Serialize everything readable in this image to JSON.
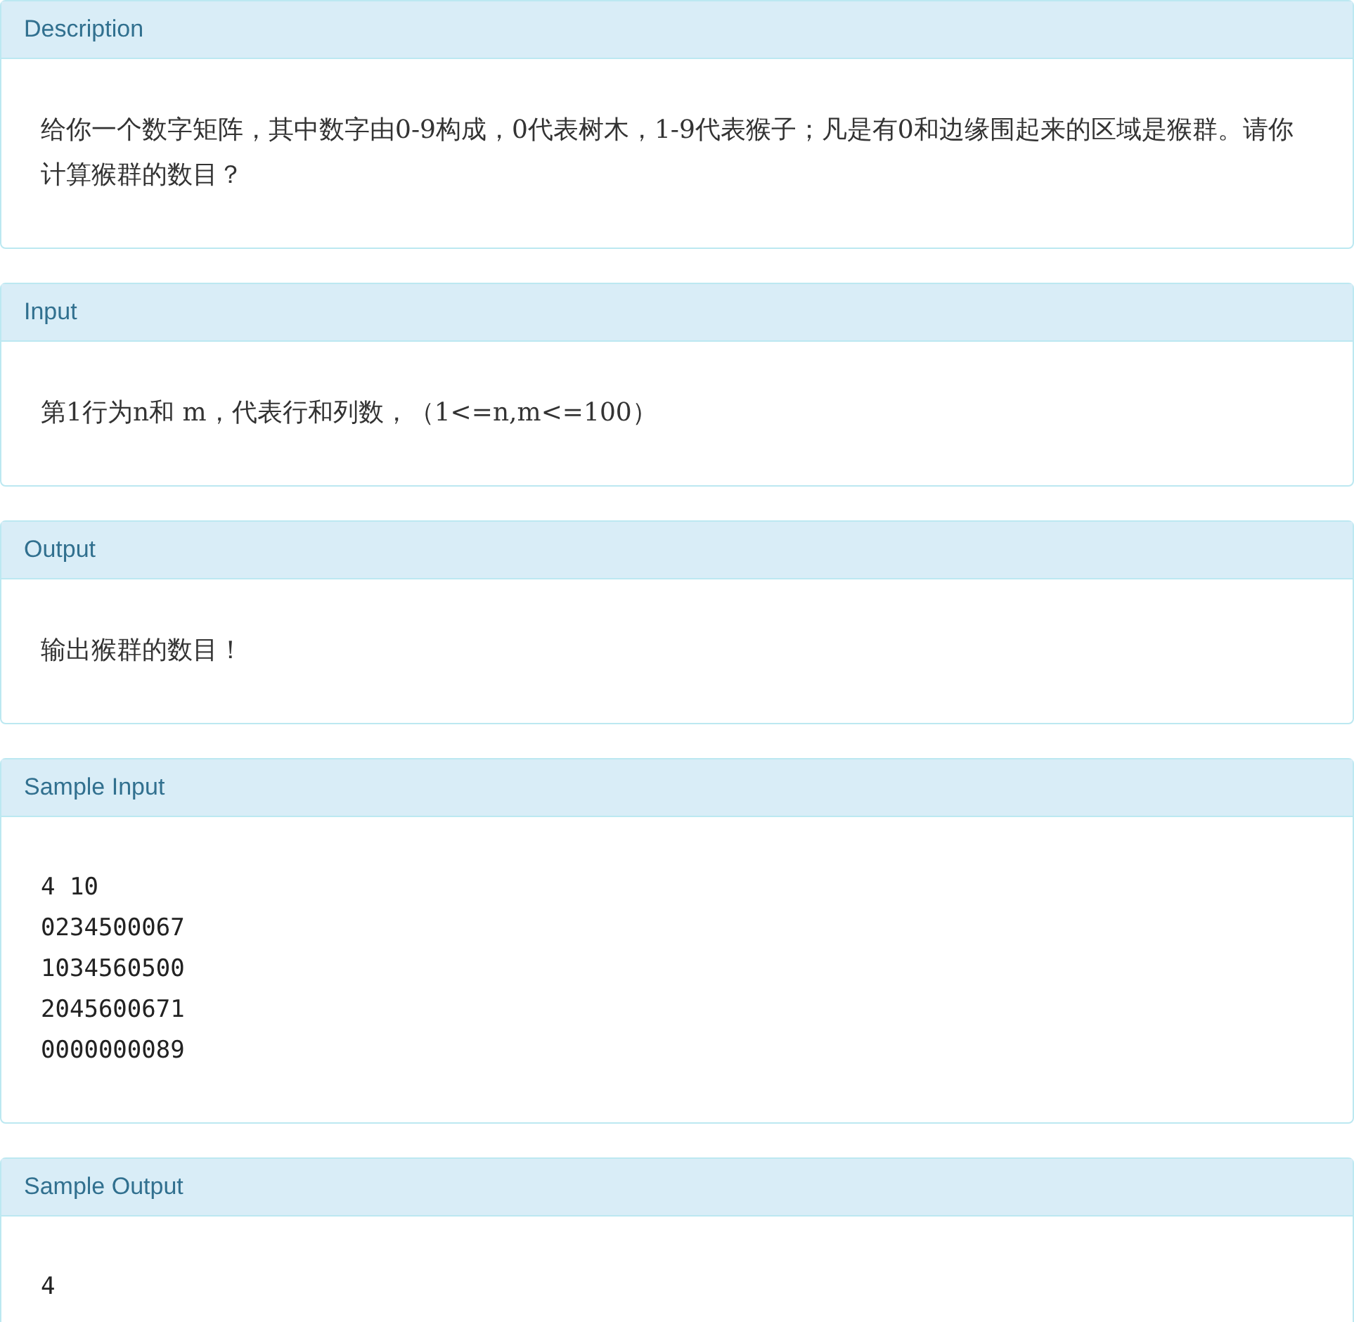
{
  "panels": [
    {
      "title": "Description",
      "kind": "text",
      "lines": [
        "给你一个数字矩阵，其中数字由0-9构成，0代表树木，1-9代表猴子；凡是有0和边缘围起来的区域是猴群。请你计算猴群的数目？"
      ]
    },
    {
      "title": "Input",
      "kind": "text",
      "lines": [
        "第1行为n和 m，代表行和列数，（1<=n,m<=100）"
      ]
    },
    {
      "title": "Output",
      "kind": "text",
      "lines": [
        "输出猴群的数目！"
      ]
    },
    {
      "title": "Sample Input",
      "kind": "code",
      "lines": [
        "4 10",
        "0234500067",
        "1034560500",
        "2045600671",
        "0000000089"
      ]
    },
    {
      "title": "Sample Output",
      "kind": "code",
      "lines": [
        "4"
      ]
    }
  ]
}
